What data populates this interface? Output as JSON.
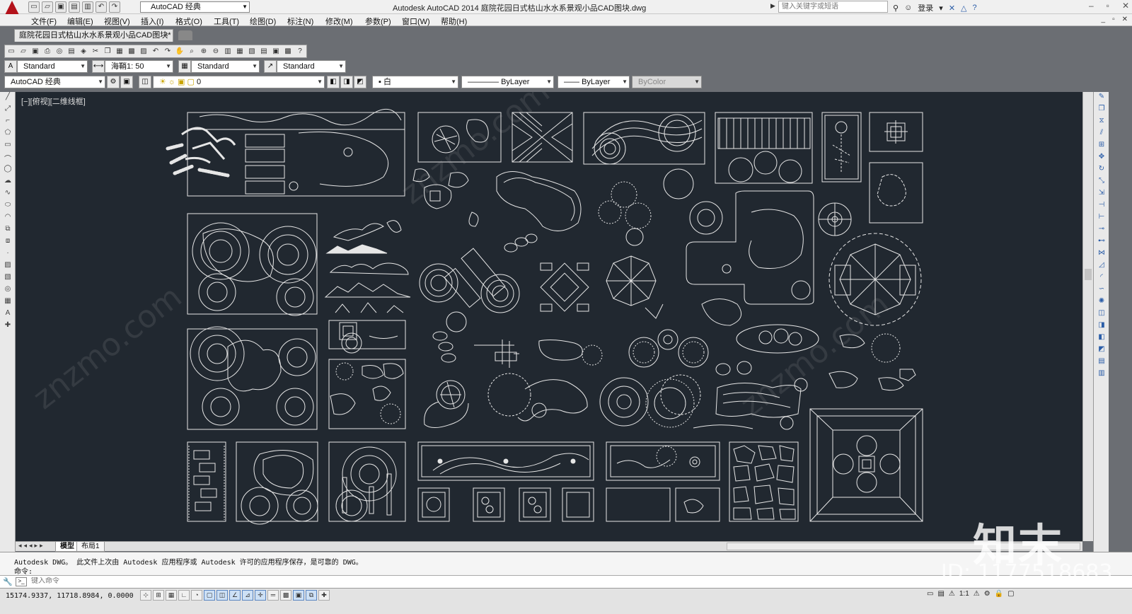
{
  "window": {
    "title": "Autodesk AutoCAD 2014    庭院花园日式枯山水水系景观小品CAD图块.dwg",
    "workspace": "AutoCAD 经典",
    "search_placeholder": "键入关键字或短语",
    "login_label": "登录",
    "controls": [
      "–",
      "▫",
      "✕"
    ]
  },
  "menu": {
    "items": [
      "文件(F)",
      "编辑(E)",
      "视图(V)",
      "插入(I)",
      "格式(O)",
      "工具(T)",
      "绘图(D)",
      "标注(N)",
      "修改(M)",
      "参数(P)",
      "窗口(W)",
      "帮助(H)"
    ]
  },
  "document": {
    "tab_label": "庭院花园日式枯山水水系景观小品CAD图块*",
    "tab_close": "×"
  },
  "styles_toolbar": {
    "text_style": "Standard",
    "dim_style": "海鞘1: 50",
    "table_style": "Standard",
    "multileader_style": "Standard"
  },
  "layers_toolbar": {
    "workspace": "AutoCAD 经典",
    "layer": "0",
    "color": "白",
    "linetype": "ByLayer",
    "lineweight": "ByLayer",
    "plotstyle": "ByColor"
  },
  "viewport": {
    "label": "[−][俯视][二维线框]"
  },
  "layout_tabs": [
    "模型",
    "布局1"
  ],
  "command": {
    "history_line1": "Autodesk DWG。  此文件上次由 Autodesk 应用程序或 Autodesk 许可的应用程序保存，是可靠的 DWG。",
    "history_line2": "命令:",
    "placeholder": "键入命令"
  },
  "status": {
    "coordinates": "15174.9337, 11718.8984, 0.0000",
    "annotation_scale": "1:1"
  },
  "watermark": {
    "logo": "知末",
    "id": "ID: 1177518683"
  },
  "colors": {
    "canvas_bg": "#212830",
    "linework": "#e6e6e6",
    "chrome": "#f0f0f0",
    "app_red": "#b3121b"
  }
}
